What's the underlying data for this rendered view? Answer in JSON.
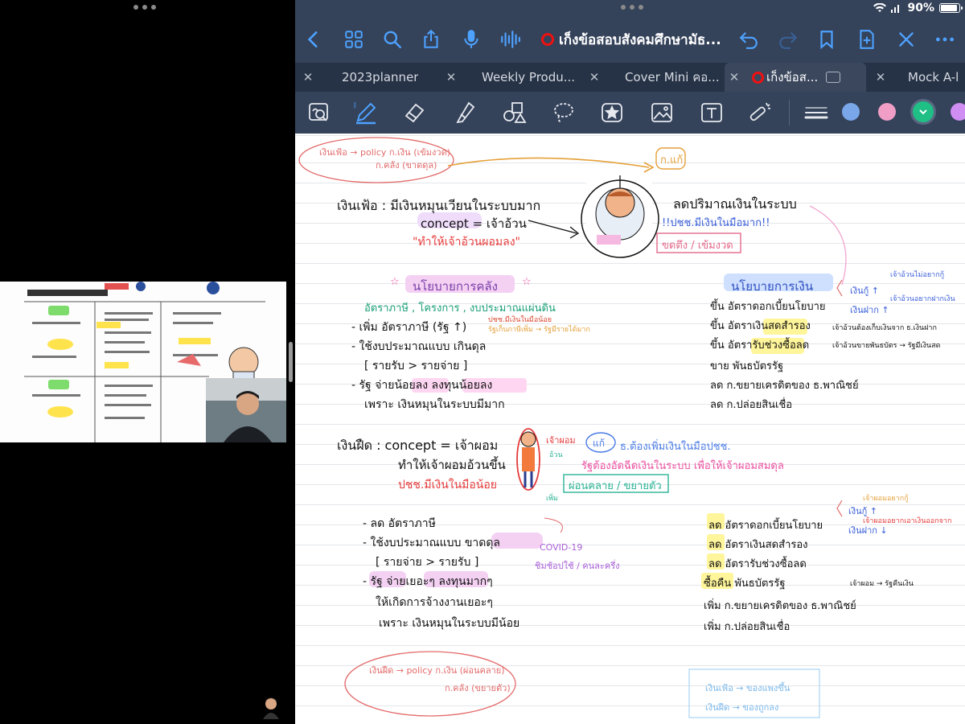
{
  "status": {
    "battery": "90%",
    "battery_level": 0.9
  },
  "toolbar": {
    "title": "เก็งข้อสอบสังคมศึกษามัธ..."
  },
  "tabs": [
    {
      "label": "2023planner"
    },
    {
      "label": "Weekly Produ..."
    },
    {
      "label": "Cover Mini คอ..."
    },
    {
      "label": "เก็งข้อส...",
      "active": true
    },
    {
      "label": "Mock A-l"
    }
  ],
  "colors": {
    "accent": "#4ea2ff",
    "topbar": "#34425a",
    "swatches": [
      "#7aa7ea",
      "#f09ec6",
      "#1fbf86",
      "#d08ef2"
    ]
  },
  "icons": [
    "back-icon",
    "grid-icon",
    "search-icon",
    "share-icon",
    "mic-icon",
    "audio-icon",
    "record-icon",
    "undo-icon",
    "redo-icon",
    "bookmark-icon",
    "add-page-icon",
    "close-icon",
    "more-icon"
  ],
  "notes": {
    "top_bubble": [
      "เงินเฟ้อ → policy ก.เงิน (เข้มงวด)",
      "ก.คลัง (ขาดดุล)"
    ],
    "inflation": {
      "title": "เงินเฟ้อ : มีเงินหมุนเวียนในระบบมาก",
      "concept": "concept = เจ้าอ้วน",
      "quote": "\"ทำให้เจ้าอ้วนผอมลง\"",
      "fix_label": "ก.แก้",
      "fix_line": "ลดปริมาณเงินในระบบ",
      "fix_note": "!!ปชช.มีเงินในมือมาก!!",
      "fix_box": "ขดตึง / เข้มงวด"
    },
    "fiscal_header": "นโยบายการคลัง",
    "monetary_header": "นโยบายการเงิน",
    "fiscal_list": [
      "อัตราภาษี , โครงการ , งบประมาณแผ่นดิน",
      "- เพิ่ม อัตราภาษี (รัฐ ↑)",
      "- ใช้งบประมาณแบบ เกินดุล",
      "[ รายรับ > รายจ่าย ]",
      "- รัฐ จ่ายน้อยลง ลงทุนน้อยลง",
      "เพราะ เงินหมุนในระบบมีมาก"
    ],
    "fiscal_side": [
      "ปชช.มีเงินในมือน้อย",
      "รัฐเก็บภาษีเพิ่ม → รัฐมีรายได้มาก"
    ],
    "monetary_list": [
      "ขึ้น อัตราดอกเบี้ยนโยบาย",
      "ขึ้น อัตราเงินสดสำรอง",
      "ขึ้น อัตรารับช่วงซื้อลด",
      "ขาย พันธบัตรรัฐ",
      "ลด ก.ขยายเครดิตของ ธ.พาณิชย์",
      "ลด ก.ปล่อยสินเชื่อ"
    ],
    "monetary_side": [
      "เงินกู้ ↑",
      "เงินฝาก ↑",
      "เจ้าอ้วนไม่อยากกู้",
      "เจ้าอ้วนอยากฝากเงิน",
      "เจ้าอ้วนต้องเก็บเงินจาก ธ.เงินฝาก",
      "เจ้าอ้วนขายพันธบัตร → รัฐมีเงินสด"
    ],
    "deflation": {
      "title": "เงินฝืด : concept = เจ้าผอม",
      "line2": "ทำให้เจ้าผอมอ้วนขึ้น",
      "line3": "ปชช.มีเงินในมือน้อย",
      "tag": "เจ้าผอม",
      "tag2": "อ้วน",
      "tag3": "เพิ่ม",
      "fix_label": "แก้",
      "fix_line": "ธ.ต้องเพิ่มเงินในมือปชช.",
      "fix_note": "รัฐต้องอัดฉีดเงินในระบบ เพื่อให้เจ้าผอมสมดุล",
      "fix_box": "ผ่อนคลาย / ขยายตัว"
    },
    "fiscal_list2": [
      "- ลด อัตราภาษี",
      "- ใช้งบประมาณแบบ ขาดดุล",
      "[ รายจ่าย > รายรับ ]",
      "- รัฐ จ่ายเยอะๆ ลงทุนมากๆ",
      "ให้เกิดการจ้างงานเยอะๆ",
      "เพราะ เงินหมุนในระบบมีน้อย"
    ],
    "covid_note": [
      "COVID-19",
      "ชิมช้อปใช้ / คนละครึ่ง"
    ],
    "monetary_list2": [
      "ลด อัตราดอกเบี้ยนโยบาย",
      "ลด อัตราเงินสดสำรอง",
      "ลด อัตรารับช่วงซื้อลด",
      "ซื้อคืน พันธบัตรรัฐ",
      "เพิ่ม ก.ขยายเครดิตของ ธ.พาณิชย์",
      "เพิ่ม ก.ปล่อยสินเชื่อ"
    ],
    "monetary_side2": [
      "เงินกู้ ↑",
      "เงินฝาก ↓",
      "เจ้าผอมอยากกู้",
      "เจ้าผอมอยากเอาเงินออกจาก",
      "เจ้าผอม → รัฐคืนเงิน"
    ],
    "bottom_bubble": [
      "เงินฝืด → policy ก.เงิน (ผ่อนคลาย)",
      "ก.คลัง (ขยายตัว)"
    ],
    "bottom_box": [
      "เงินเฟ้อ → ของแพงขึ้น",
      "เงินฝืด → ของถูกลง"
    ]
  }
}
